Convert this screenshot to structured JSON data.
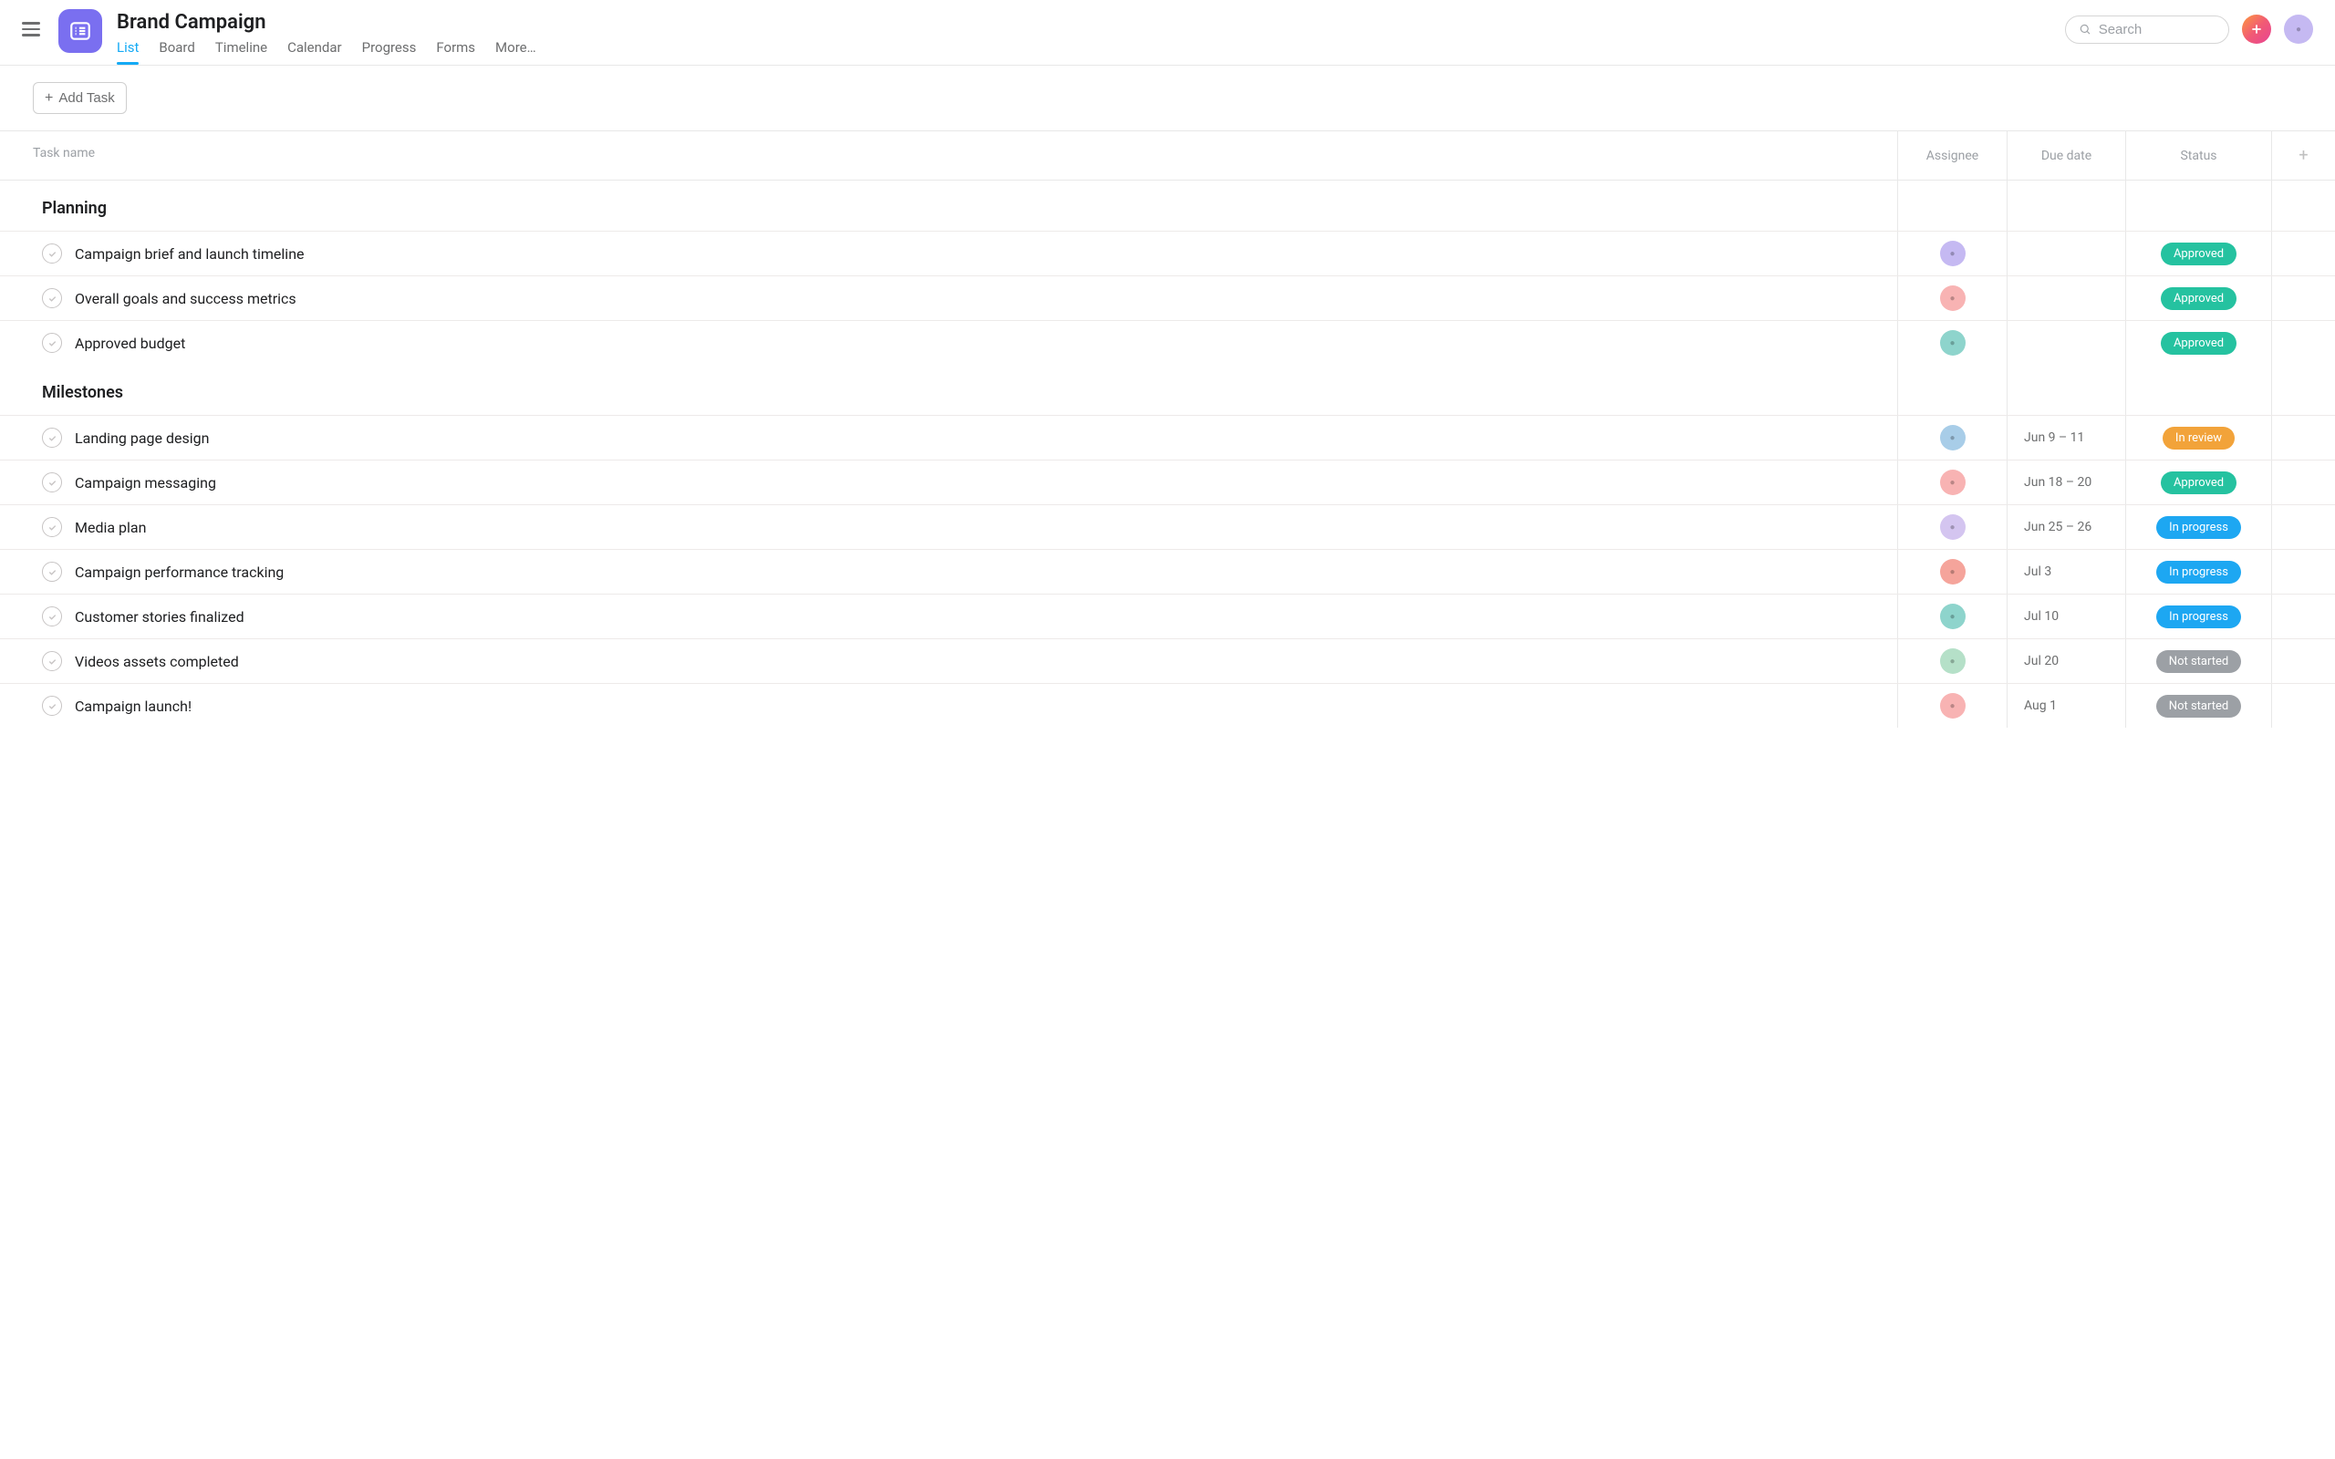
{
  "header": {
    "project_title": "Brand Campaign",
    "tabs": [
      "List",
      "Board",
      "Timeline",
      "Calendar",
      "Progress",
      "Forms",
      "More…"
    ],
    "active_tab_index": 0,
    "search_placeholder": "Search"
  },
  "toolbar": {
    "add_task_label": "Add Task"
  },
  "columns": {
    "task": "Task name",
    "assignee": "Assignee",
    "due": "Due date",
    "status": "Status"
  },
  "status_colors": {
    "Approved": "#25c2a0",
    "In review": "#f2a33a",
    "In progress": "#1da7f2",
    "Not started": "#9ca0a5"
  },
  "avatar_colors": {
    "user1": "av-purple",
    "user2": "av-pink",
    "user3": "av-teal",
    "user4": "av-blue",
    "user5": "av-lav",
    "user6": "av-coral",
    "user7": "av-mint"
  },
  "sections": [
    {
      "title": "Planning",
      "tasks": [
        {
          "name": "Campaign brief and launch timeline",
          "assignee": "user1",
          "due": "",
          "status": "Approved"
        },
        {
          "name": "Overall goals and success metrics",
          "assignee": "user2",
          "due": "",
          "status": "Approved"
        },
        {
          "name": "Approved budget",
          "assignee": "user3",
          "due": "",
          "status": "Approved"
        }
      ]
    },
    {
      "title": "Milestones",
      "tasks": [
        {
          "name": "Landing page design",
          "assignee": "user4",
          "due": "Jun 9 – 11",
          "status": "In review"
        },
        {
          "name": "Campaign messaging",
          "assignee": "user2",
          "due": "Jun 18 – 20",
          "status": "Approved"
        },
        {
          "name": "Media plan",
          "assignee": "user5",
          "due": "Jun 25 – 26",
          "status": "In progress"
        },
        {
          "name": "Campaign performance tracking",
          "assignee": "user6",
          "due": "Jul 3",
          "status": "In progress"
        },
        {
          "name": "Customer stories finalized",
          "assignee": "user3",
          "due": "Jul 10",
          "status": "In progress"
        },
        {
          "name": "Videos assets completed",
          "assignee": "user7",
          "due": "Jul 20",
          "status": "Not started"
        },
        {
          "name": "Campaign launch!",
          "assignee": "user2",
          "due": "Aug 1",
          "status": "Not started"
        }
      ]
    }
  ]
}
